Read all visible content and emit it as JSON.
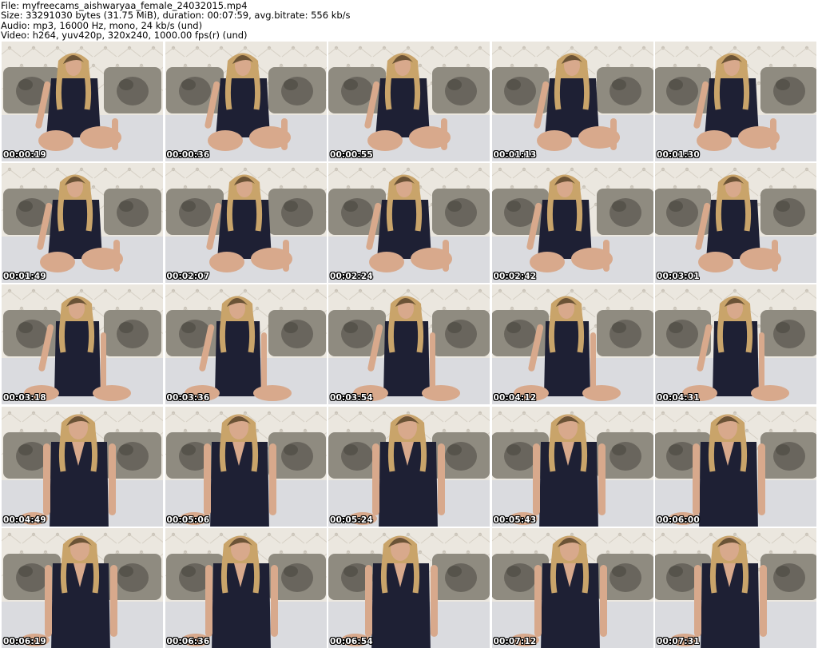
{
  "header": {
    "file_line": "File: myfreecams_aishwaryaa_female_24032015.mp4",
    "size_line": "Size: 33291030 bytes (31.75 MiB), duration: 00:07:59, avg.bitrate: 556 kb/s",
    "audio_line": "Audio: mp3, 16000 Hz, mono, 24 kb/s (und)",
    "video_line": "Video: h264, yuv420p, 320x240, 1000.00 fps(r) (und)"
  },
  "thumbnails": [
    {
      "timestamp": "00:00:19",
      "pose": "sit"
    },
    {
      "timestamp": "00:00:36",
      "pose": "sit"
    },
    {
      "timestamp": "00:00:55",
      "pose": "sit"
    },
    {
      "timestamp": "00:01:13",
      "pose": "sit"
    },
    {
      "timestamp": "00:01:30",
      "pose": "sit"
    },
    {
      "timestamp": "00:01:49",
      "pose": "sit"
    },
    {
      "timestamp": "00:02:07",
      "pose": "sit"
    },
    {
      "timestamp": "00:02:24",
      "pose": "sit"
    },
    {
      "timestamp": "00:02:42",
      "pose": "sit"
    },
    {
      "timestamp": "00:03:01",
      "pose": "sit"
    },
    {
      "timestamp": "00:03:18",
      "pose": "kneel"
    },
    {
      "timestamp": "00:03:36",
      "pose": "kneel"
    },
    {
      "timestamp": "00:03:54",
      "pose": "kneel"
    },
    {
      "timestamp": "00:04:12",
      "pose": "kneel"
    },
    {
      "timestamp": "00:04:31",
      "pose": "kneel"
    },
    {
      "timestamp": "00:04:49",
      "pose": "close"
    },
    {
      "timestamp": "00:05:06",
      "pose": "close"
    },
    {
      "timestamp": "00:05:24",
      "pose": "close"
    },
    {
      "timestamp": "00:05:43",
      "pose": "close"
    },
    {
      "timestamp": "00:06:00",
      "pose": "close"
    },
    {
      "timestamp": "00:06:19",
      "pose": "close"
    },
    {
      "timestamp": "00:06:36",
      "pose": "close"
    },
    {
      "timestamp": "00:06:54",
      "pose": "close"
    },
    {
      "timestamp": "00:07:12",
      "pose": "close"
    },
    {
      "timestamp": "00:07:31",
      "pose": "close"
    }
  ],
  "colors": {
    "headboard": "#ebe7df",
    "button": "#c9c3b8",
    "pillow": "#8f8b80",
    "pillow_print": "#4a4740",
    "bed": "#dadbdf",
    "hair": "#c9a46a",
    "hair_root": "#6b5336",
    "skin": "#d8a98c",
    "outfit": "#1e2034"
  }
}
